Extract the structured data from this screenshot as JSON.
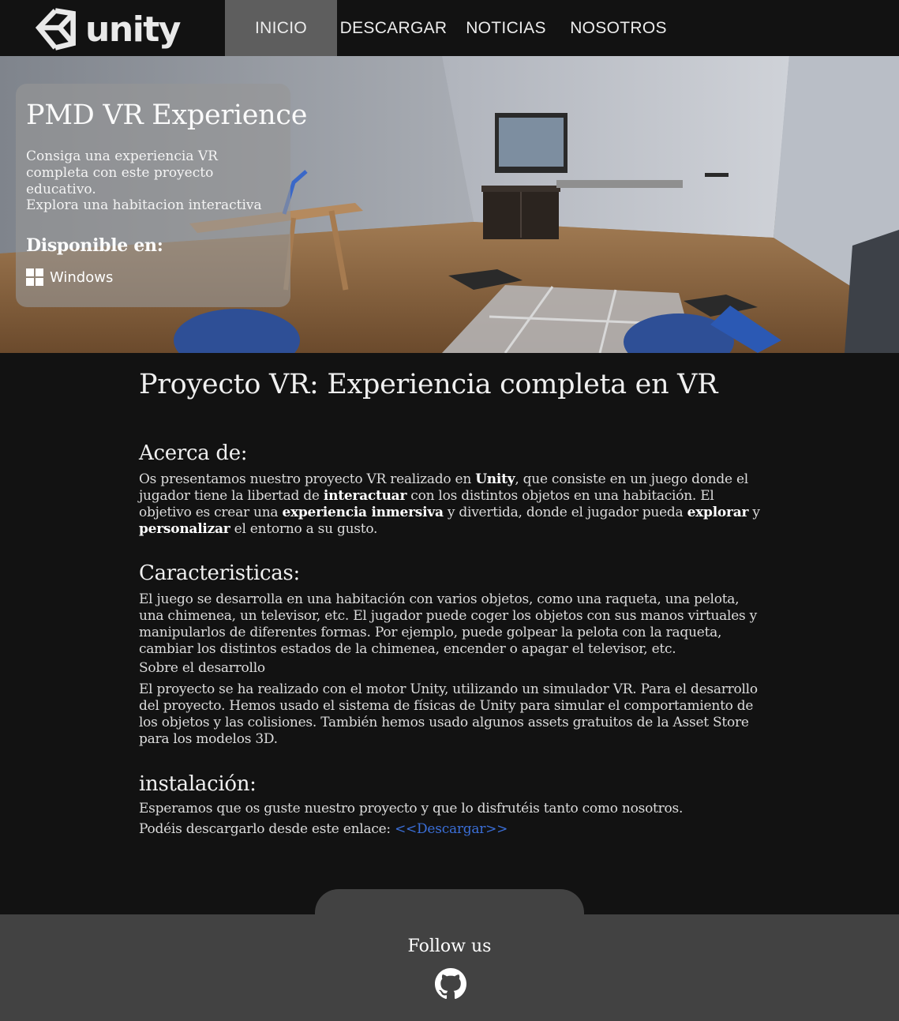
{
  "nav": {
    "logo_text": "unity",
    "items": [
      "INICIO",
      "DESCARGAR",
      "NOTICIAS",
      "NOSOTROS"
    ],
    "active": "INICIO"
  },
  "hero": {
    "title": "PMD VR Experience",
    "desc1": "Consiga una experiencia VR completa con este proyecto educativo.",
    "desc2": "Explora una habitacion interactiva",
    "available_label": "Disponible en:",
    "platform": "Windows",
    "platform_icon": "windows-icon"
  },
  "main": {
    "title": "Proyecto VR: Experiencia completa en VR",
    "about": {
      "heading": "Acerca de:",
      "p1": "Os presentamos nuestro proyecto VR realizado en ",
      "b1": "Unity",
      "p2": ", que consiste en un juego donde el jugador tiene la libertad de ",
      "b2": "interactuar",
      "p3": " con los distintos objetos en una habitación. El objetivo es crear una ",
      "b3": "experiencia inmersiva",
      "p4": " y divertida, donde el jugador pueda ",
      "b4": "explorar",
      "p5": " y ",
      "b5": "personalizar",
      "p6": " el entorno a su gusto."
    },
    "features": {
      "heading": "Caracteristicas:",
      "body": "El juego se desarrolla en una habitación con varios objetos, como una raqueta, una pelota, una chimenea, un televisor, etc. El jugador puede coger los objetos con sus manos virtuales y manipularlos de diferentes formas. Por ejemplo, puede golpear la pelota con la raqueta, cambiar los distintos estados de la chimenea, encender o apagar el televisor, etc.",
      "sub": "Sobre el desarrollo",
      "dev": "El proyecto se ha realizado con el motor Unity, utilizando un simulador VR. Para el desarrollo del proyecto. Hemos usado el sistema de físicas de Unity para simular el comportamiento de los objetos y las colisiones. También hemos usado algunos assets gratuitos de la Asset Store para los modelos 3D."
    },
    "install": {
      "heading": "instalación:",
      "line1": "Esperamos que os guste nuestro proyecto y que lo disfrutéis tanto como nosotros.",
      "line2": "Podéis descargarlo desde este enlace: ",
      "link": "<<Descargar>>"
    }
  },
  "footer": {
    "follow": "Follow us",
    "icon": "github-icon"
  },
  "colors": {
    "background": "#121212",
    "nav_active": "#5e5e5e",
    "footer": "#424242",
    "link": "#3b6fd8"
  }
}
